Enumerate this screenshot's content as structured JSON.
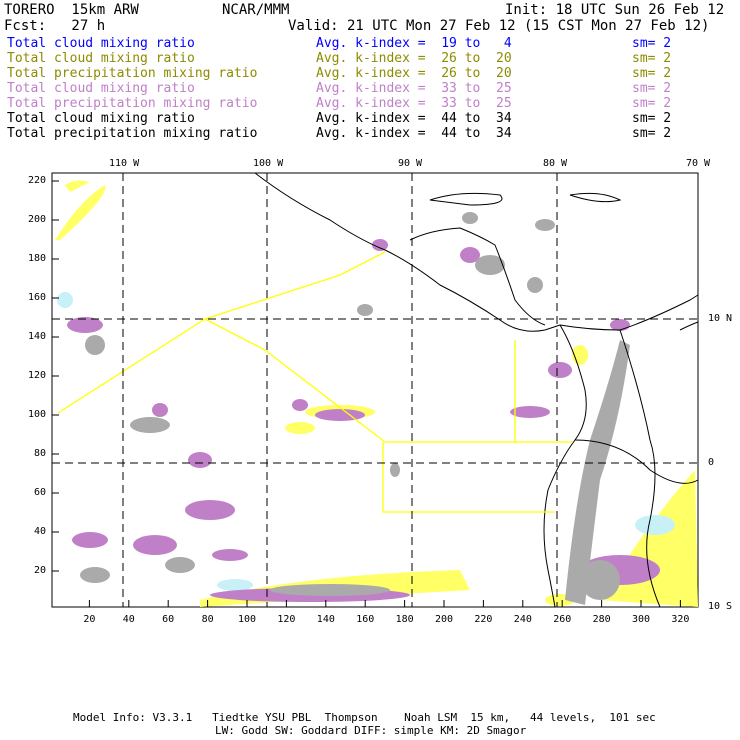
{
  "header": {
    "model": "TORERO  15km ARW",
    "org": "NCAR/MMM",
    "init": "Init: 18 UTC Sun 26 Feb 12",
    "fcst": "Fcst:   27 h",
    "valid": "Valid: 21 UTC Mon 27 Feb 12 (15 CST Mon 27 Feb 12)"
  },
  "legend": [
    {
      "field": "Total cloud mixing ratio",
      "kindex": "Avg. k-index =  19 to   4",
      "sm": "sm= 2",
      "color": "#0000ff"
    },
    {
      "field": "Total cloud mixing ratio",
      "kindex": "Avg. k-index =  26 to  20",
      "sm": "sm= 2",
      "color": "#8c8c00"
    },
    {
      "field": "Total precipitation mixing ratio",
      "kindex": "Avg. k-index =  26 to  20",
      "sm": "sm= 2",
      "color": "#8c8c00"
    },
    {
      "field": "Total cloud mixing ratio",
      "kindex": "Avg. k-index =  33 to  25",
      "sm": "sm= 2",
      "color": "#c080c8"
    },
    {
      "field": "Total precipitation mixing ratio",
      "kindex": "Avg. k-index =  33 to  25",
      "sm": "sm= 2",
      "color": "#c080c8"
    },
    {
      "field": "Total cloud mixing ratio",
      "kindex": "Avg. k-index =  44 to  34",
      "sm": "sm= 2",
      "color": "#000000"
    },
    {
      "field": "Total precipitation mixing ratio",
      "kindex": "Avg. k-index =  44 to  34",
      "sm": "sm= 2",
      "color": "#000000"
    }
  ],
  "axes": {
    "x_ticks": [
      "20",
      "40",
      "60",
      "80",
      "100",
      "120",
      "140",
      "160",
      "180",
      "200",
      "220",
      "240",
      "260",
      "280",
      "300",
      "320"
    ],
    "y_ticks": [
      "20",
      "40",
      "60",
      "80",
      "100",
      "120",
      "140",
      "160",
      "180",
      "200",
      "220"
    ],
    "lon_labels": [
      "110 W",
      "100 W",
      "90 W",
      "80 W",
      "70 W"
    ],
    "lat_labels": [
      "10 N",
      "0",
      "10 S"
    ]
  },
  "footer": {
    "line1": "Model Info: V3.3.1   Tiedtke YSU PBL  Thompson    Noah LSM  15 km,   44 levels,  101 sec",
    "line2": "LW: Godd SW: Goddard DIFF: simple KM: 2D Smagor"
  }
}
